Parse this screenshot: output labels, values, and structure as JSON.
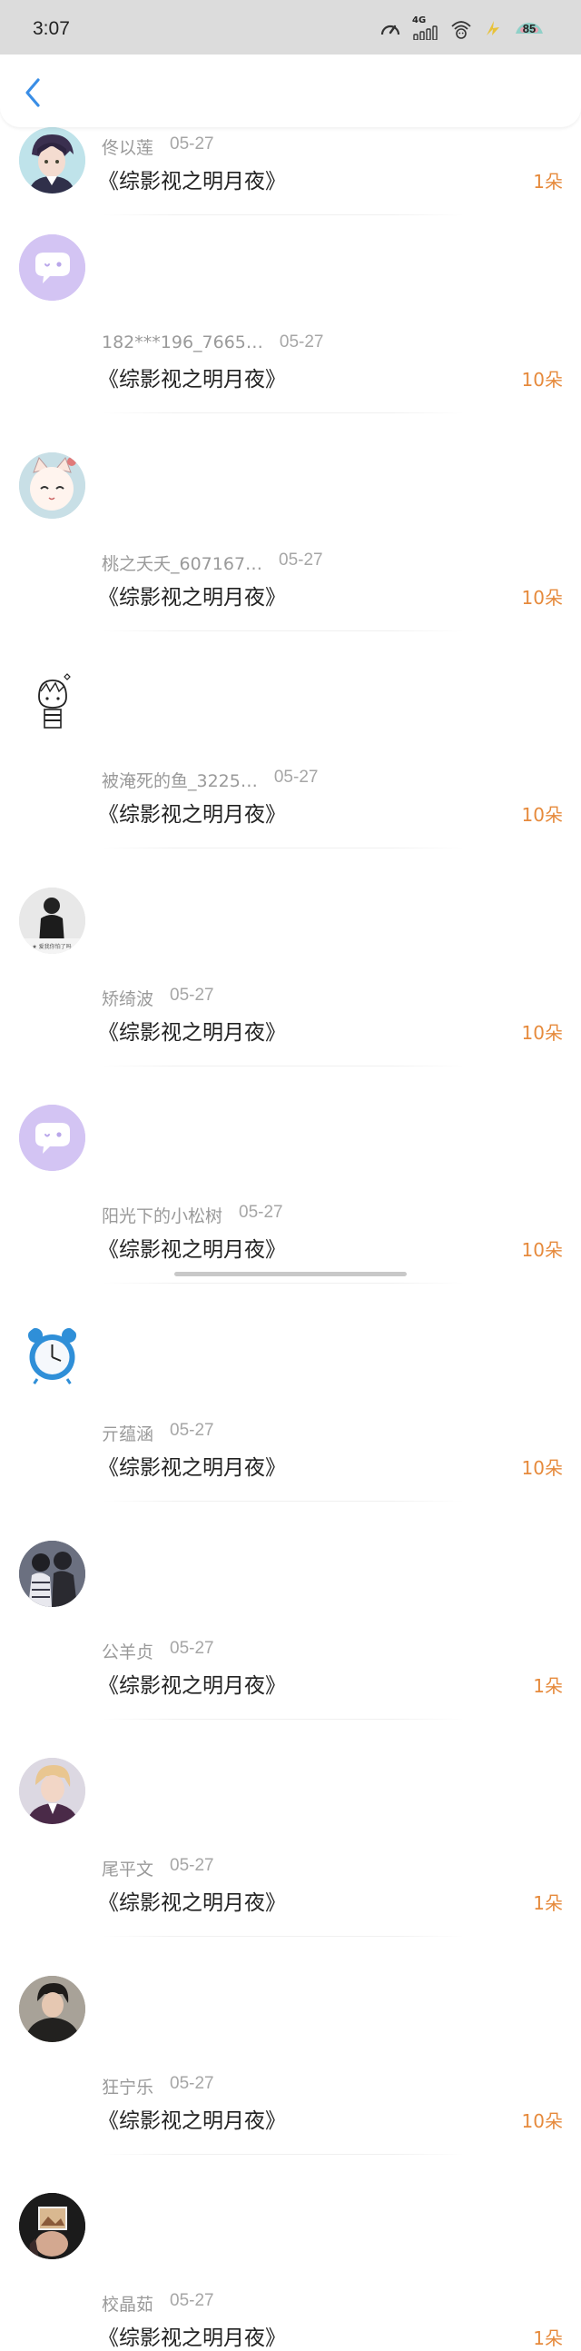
{
  "status_bar": {
    "time": "3:07",
    "network": "4G",
    "battery": "85",
    "icons": [
      "speedometer-icon",
      "signal-icon",
      "wifi-icon",
      "charging-icon",
      "battery-icon"
    ]
  },
  "header": {
    "back_icon": "chevron-left-icon"
  },
  "colors": {
    "amount": "#e68a3c",
    "back": "#3a8ee6",
    "status_bg": "#dcdcdc"
  },
  "items": [
    {
      "name": "佟以莲",
      "date": "05-27",
      "title": "《综影视之明月夜》",
      "amount": "1朵",
      "avatar": "anime-boy-avatar"
    },
    {
      "name": "182***196_7665…",
      "date": "05-27",
      "title": "《综影视之明月夜》",
      "amount": "10朵",
      "avatar": "default-chat-avatar"
    },
    {
      "name": "桃之夭夭_607167…",
      "date": "05-27",
      "title": "《综影视之明月夜》",
      "amount": "10朵",
      "avatar": "cat-avatar"
    },
    {
      "name": "被淹死的鱼_3225…",
      "date": "05-27",
      "title": "《综影视之明月夜》",
      "amount": "10朵",
      "avatar": "doodle-girl-avatar"
    },
    {
      "name": "矫绮波",
      "date": "05-27",
      "title": "《综影视之明月夜》",
      "amount": "10朵",
      "avatar": "photo-avatar",
      "avatar_caption": "★ 爱我你怕了吗"
    },
    {
      "name": "阳光下的小松树",
      "date": "05-27",
      "title": "《综影视之明月夜》",
      "amount": "10朵",
      "avatar": "default-chat-avatar"
    },
    {
      "name": "亓蕴涵",
      "date": "05-27",
      "title": "《综影视之明月夜》",
      "amount": "10朵",
      "avatar": "alarm-clock-avatar"
    },
    {
      "name": "公羊贞",
      "date": "05-27",
      "title": "《综影视之明月夜》",
      "amount": "1朵",
      "avatar": "couple-photo-avatar"
    },
    {
      "name": "尾平文",
      "date": "05-27",
      "title": "《综影视之明月夜》",
      "amount": "1朵",
      "avatar": "portrait-photo-avatar"
    },
    {
      "name": "狂宁乐",
      "date": "05-27",
      "title": "《综影视之明月夜》",
      "amount": "10朵",
      "avatar": "portrait-photo-avatar"
    },
    {
      "name": "校晶茹",
      "date": "05-27",
      "title": "《综影视之明月夜》",
      "amount": "1朵",
      "avatar": "photo-avatar"
    }
  ]
}
